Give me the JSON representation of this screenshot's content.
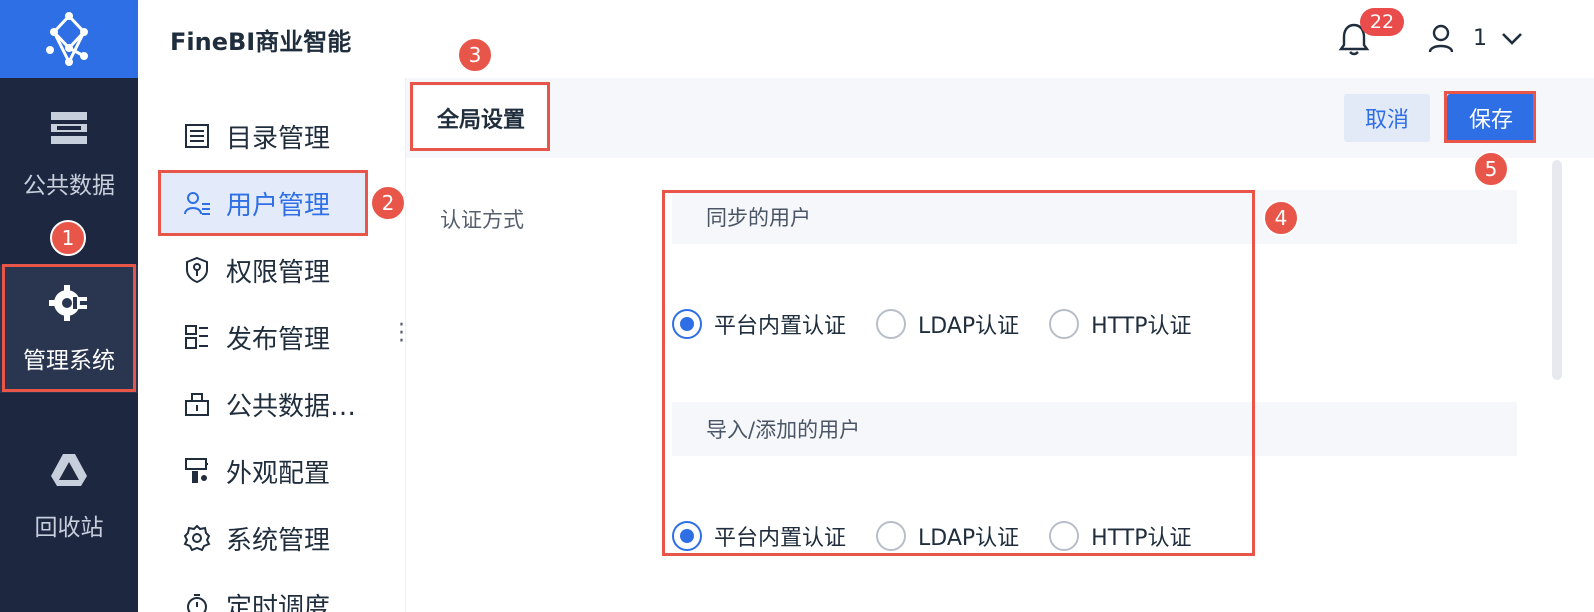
{
  "app": {
    "title": "FineBI商业智能"
  },
  "header": {
    "notification_count": "22",
    "user_name": "1"
  },
  "rail": {
    "items": [
      {
        "label": "公共数据",
        "icon": "database-icon"
      },
      {
        "label": "管理系统",
        "icon": "gear-admin-icon",
        "active": true
      },
      {
        "label": "回收站",
        "icon": "recycle-bin-icon"
      }
    ]
  },
  "submenu": {
    "items": [
      {
        "label": "目录管理",
        "icon": "list-icon"
      },
      {
        "label": "用户管理",
        "icon": "user-manage-icon",
        "active": true
      },
      {
        "label": "权限管理",
        "icon": "shield-key-icon"
      },
      {
        "label": "发布管理",
        "icon": "publish-icon"
      },
      {
        "label": "公共数据…",
        "icon": "public-data-icon"
      },
      {
        "label": "外观配置",
        "icon": "paint-icon"
      },
      {
        "label": "系统管理",
        "icon": "settings-icon"
      },
      {
        "label": "定时调度",
        "icon": "timer-icon"
      }
    ]
  },
  "main": {
    "tab": "全局设置",
    "cancel_label": "取消",
    "save_label": "保存",
    "auth_label": "认证方式",
    "groups": [
      {
        "title": "同步的用户",
        "options": [
          "平台内置认证",
          "LDAP认证",
          "HTTP认证"
        ],
        "selected": 0
      },
      {
        "title": "导入/添加的用户",
        "options": [
          "平台内置认证",
          "LDAP认证",
          "HTTP认证"
        ],
        "selected": 0
      }
    ]
  },
  "annotations": [
    "1",
    "2",
    "3",
    "4",
    "5"
  ],
  "colors": {
    "accent": "#2f6fe6",
    "rail_bg": "#1d2740",
    "annotation": "#e8564a"
  }
}
